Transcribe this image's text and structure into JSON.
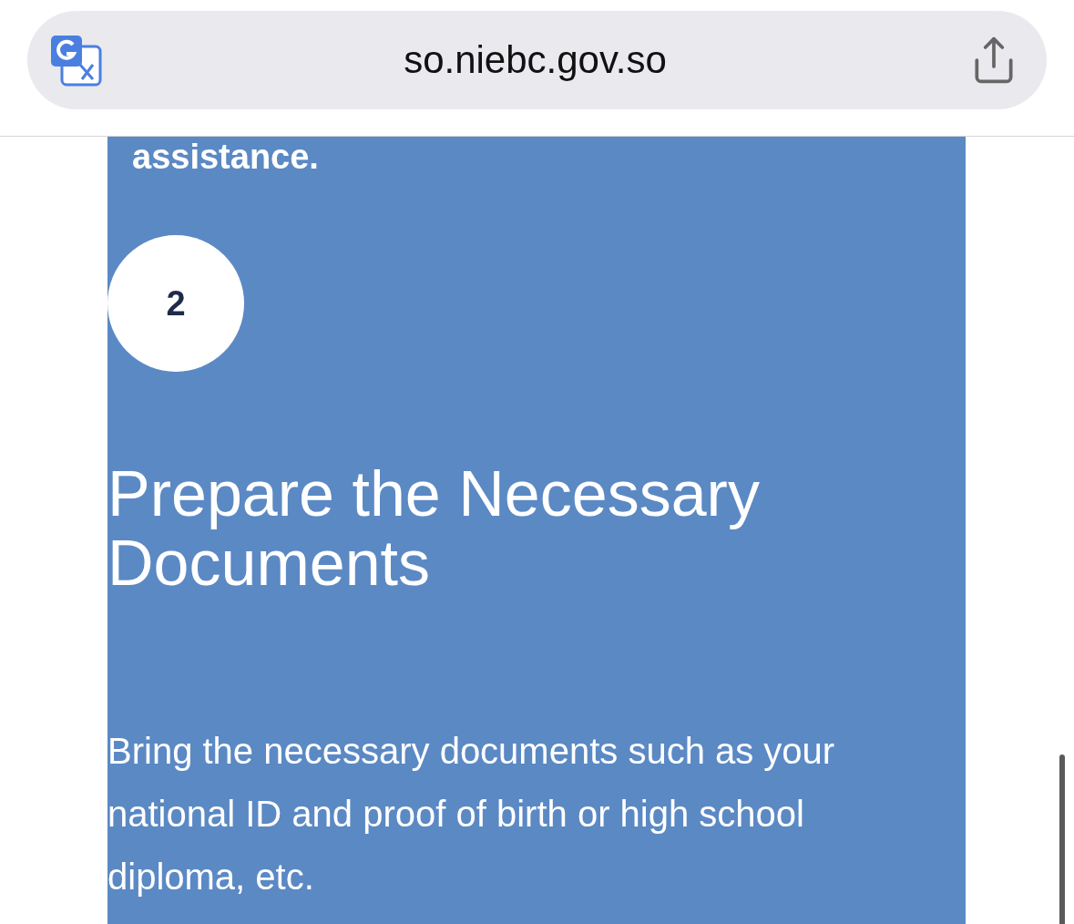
{
  "browser": {
    "url": "so.niebc.gov.so"
  },
  "page": {
    "cut_text": "assistance.",
    "step": {
      "number": "2",
      "title": "Prepare the Necessary Documents",
      "body": "Bring the necessary documents such as your national ID and proof of birth or high school diploma, etc."
    }
  }
}
